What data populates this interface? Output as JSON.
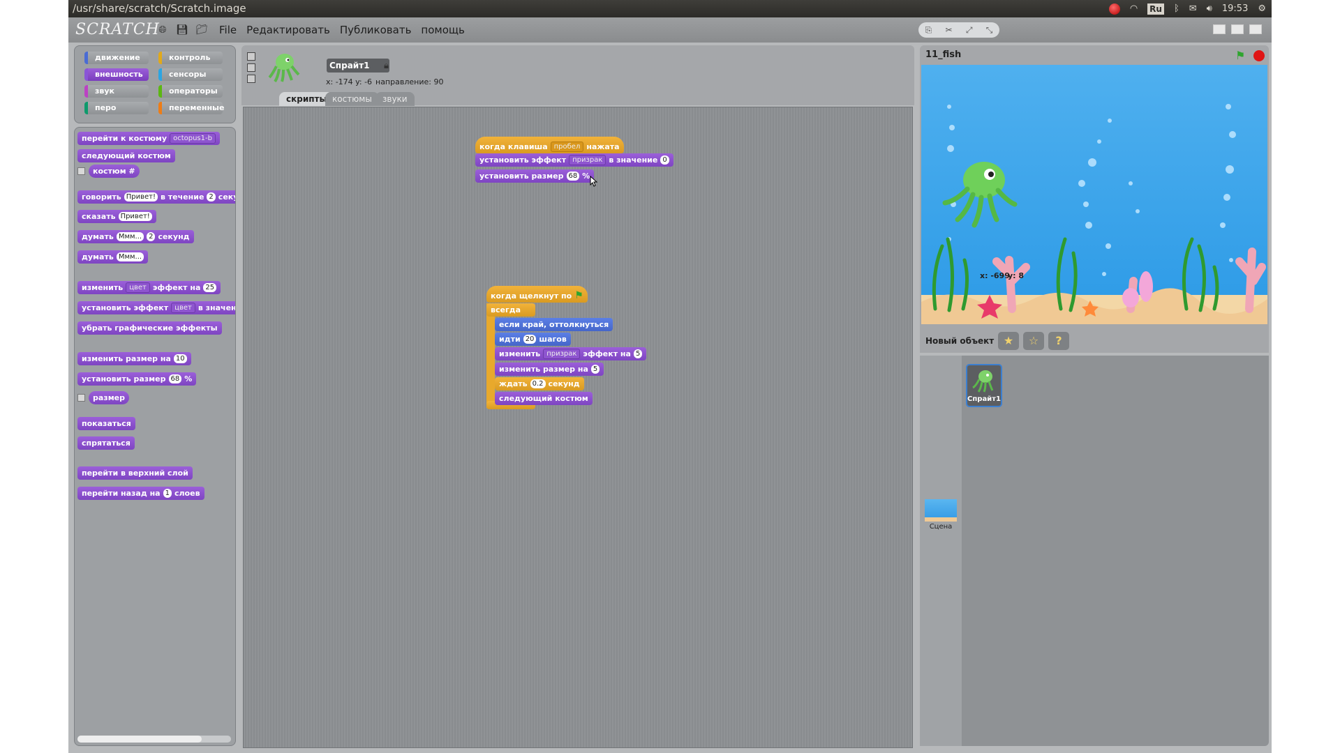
{
  "window": {
    "title": "/usr/share/scratch/Scratch.image"
  },
  "tray": {
    "keyboard": "Ru",
    "time": "19:53"
  },
  "menu": {
    "logo": "SCRATCH",
    "items": [
      "File",
      "Редактировать",
      "Публиковать",
      "помощь"
    ]
  },
  "categories": [
    {
      "label": "движение",
      "color": "#4a6cd4"
    },
    {
      "label": "контроль",
      "color": "#e1a91a"
    },
    {
      "label": "внешность",
      "color": "#8a55d7"
    },
    {
      "label": "сенсоры",
      "color": "#2ca5e2"
    },
    {
      "label": "звук",
      "color": "#bb42c3"
    },
    {
      "label": "операторы",
      "color": "#5cb712"
    },
    {
      "label": "перо",
      "color": "#0e9a6c"
    },
    {
      "label": "переменные",
      "color": "#ee7d16"
    }
  ],
  "palette": {
    "switch_costume": "перейти к костюму",
    "costume_name": "octopus1-b",
    "next_costume": "следующий костюм",
    "costume_num": "костюм #",
    "say_for_1": "говорить",
    "say_for_msg": "Привет!",
    "say_for_2": "в течение",
    "say_for_secs": "2",
    "say_for_3": "секунд",
    "say": "сказать",
    "say_msg": "Привет!",
    "think_for_1": "думать",
    "think_for_msg": "Ммм...",
    "think_for_secs": "2",
    "think_for_2": "секунд",
    "think": "думать",
    "think_msg": "Ммм...",
    "change_effect_1": "изменить",
    "change_effect_drop": "цвет",
    "change_effect_2": "эффект на",
    "change_effect_val": "25",
    "set_effect_1": "установить эффект",
    "set_effect_drop": "цвет",
    "set_effect_2": "в значение",
    "clear_effects": "убрать графические эффекты",
    "change_size_1": "изменить размер на",
    "change_size_val": "10",
    "set_size_1": "установить размер",
    "set_size_val": "68",
    "set_size_pct": "%",
    "size": "размер",
    "show": "показаться",
    "hide": "спрятаться",
    "go_front": "перейти в верхний слой",
    "go_back_1": "перейти назад на",
    "go_back_val": "1",
    "go_back_2": "слоев"
  },
  "sprite": {
    "name": "Спрайт1",
    "coords": "x: -174  y: -6",
    "direction": "направление: 90"
  },
  "tabs": [
    "скрипты",
    "костюмы",
    "звуки"
  ],
  "script1": {
    "hat_1": "когда клавиша",
    "hat_drop": "пробел",
    "hat_2": "нажата",
    "set_effect_1": "установить эффект",
    "set_effect_drop": "призрак",
    "set_effect_2": "в значение",
    "set_effect_val": "0",
    "set_size_1": "установить размер",
    "set_size_val": "68",
    "set_size_pct": "%"
  },
  "script2": {
    "hat": "когда щелкнут по",
    "forever": "всегда",
    "bounce": "если край, оттолкнуться",
    "move_1": "идти",
    "move_val": "20",
    "move_2": "шагов",
    "change_effect_1": "изменить",
    "change_effect_drop": "призрак",
    "change_effect_2": "эффект на",
    "change_effect_val": "5",
    "change_size_1": "изменить размер на",
    "change_size_val": "5",
    "wait_1": "ждать",
    "wait_val": "0.2",
    "wait_2": "секунд",
    "next_costume": "следующий костюм"
  },
  "stage": {
    "title": "11_fish",
    "mouse_x": "x: -699",
    "mouse_y": "y: 8"
  },
  "sprites_panel": {
    "new_sprite": "Новый объект",
    "sprite_label": "Спрайт1",
    "stage_label": "Сцена"
  }
}
